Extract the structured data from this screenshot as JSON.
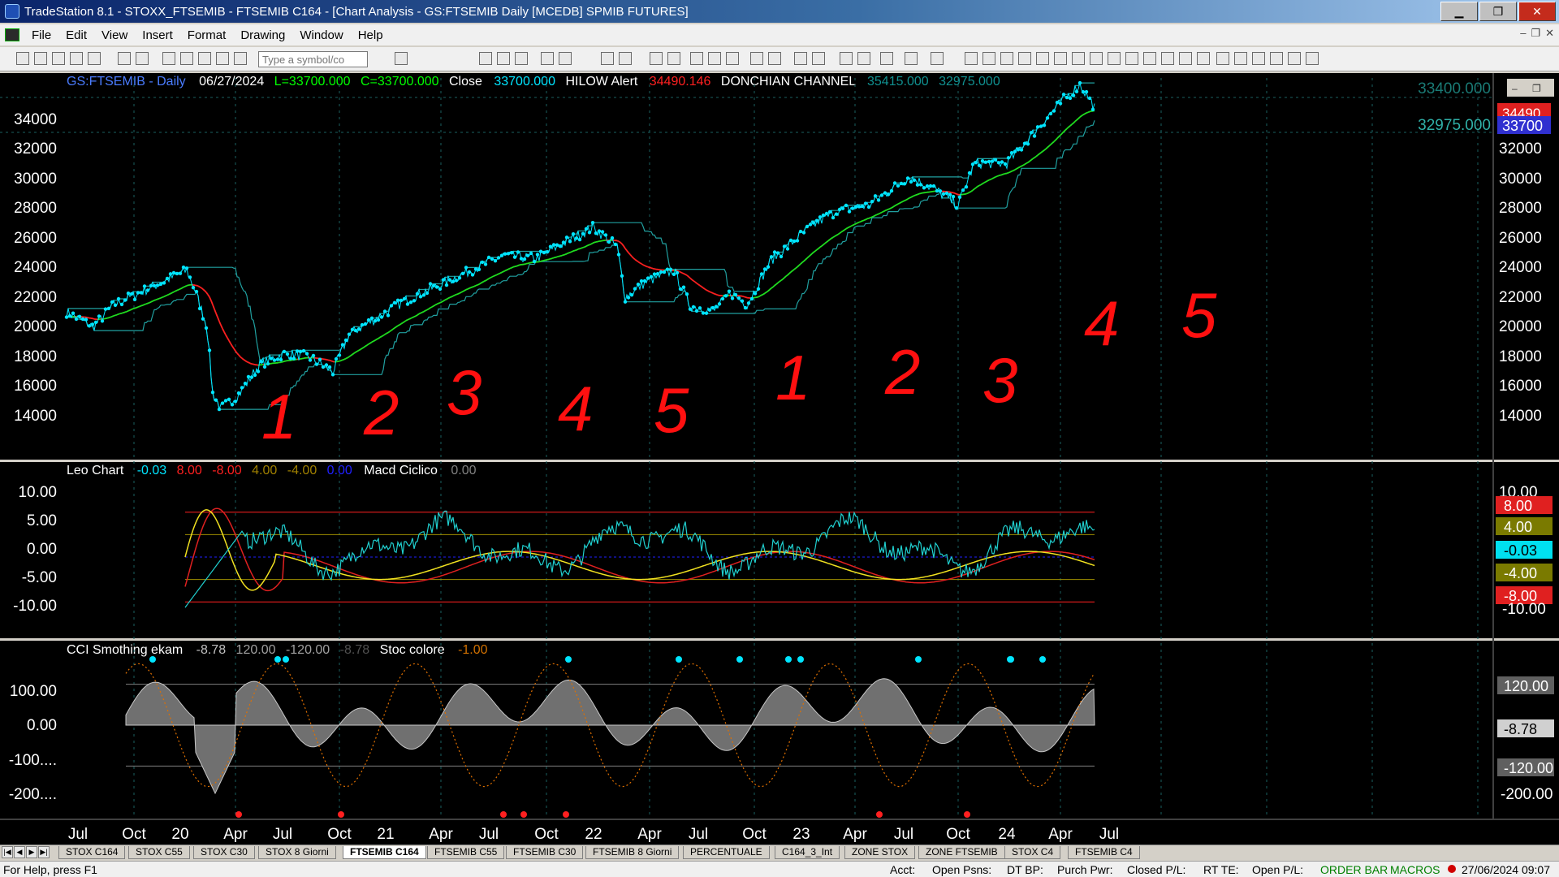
{
  "window": {
    "title": "TradeStation 8.1 - STOXX_FTSEMIB - FTSEMIB C164 - [Chart Analysis - GS:FTSEMIB  Daily  [MCEDB] SPMIB FUTURES]",
    "min": "▁",
    "max": "❐",
    "close": "✕"
  },
  "menu": [
    "File",
    "Edit",
    "View",
    "Insert",
    "Format",
    "Drawing",
    "Window",
    "Help"
  ],
  "mdi_controls": [
    "–",
    "❐",
    "✕"
  ],
  "toolbar": {
    "symbol_placeholder": "Type a symbol/co"
  },
  "price_header": {
    "symbol": "GS:FTSEMIB - Daily",
    "date": "06/27/2024",
    "low": "L=33700.000",
    "close": "C=33700.000",
    "close_label": "Close",
    "close_value": "33700.000",
    "hilow_label": "HILOW Alert",
    "hilow_value": "34490.146",
    "donchian_label": "DONCHIAN CHANNEL",
    "donchian_upper": "35415.000",
    "donchian_lower": "32975.000"
  },
  "price_axis": {
    "ticks": [
      "34000",
      "32000",
      "30000",
      "28000",
      "26000",
      "24000",
      "22000",
      "20000",
      "18000",
      "16000",
      "14000"
    ],
    "right_ticks": [
      "32000",
      "30000",
      "28000",
      "26000",
      "24000",
      "22000",
      "20000",
      "18000",
      "16000",
      "14000"
    ],
    "badge_red": "34490",
    "badge_blue": "33700",
    "level_label": "32975.000",
    "partial_top": "33400.000"
  },
  "wave_labels": [
    "1",
    "2",
    "3",
    "4",
    "5",
    "1",
    "2",
    "3",
    "4",
    "5"
  ],
  "leo_header": {
    "name": "Leo Chart",
    "v1": "-0.03",
    "v2": "8.00",
    "v3": "-8.00",
    "v4": "4.00",
    "v5": "-4.00",
    "v6": "0.00",
    "macd_label": "Macd Ciclico",
    "macd_value": "0.00"
  },
  "leo_axis": {
    "ticks": [
      "10.00",
      "5.00",
      "0.00",
      "-5.00",
      "-10.00"
    ],
    "badges": [
      "8.00",
      "4.00",
      "-0.03",
      "-4.00",
      "-8.00"
    ],
    "right_ticks": [
      "10.00",
      "-10.00"
    ]
  },
  "cci_header": {
    "name": "CCI Smothing ekam",
    "v1": "-8.78",
    "v2": "120.00",
    "v3": "-120.00",
    "v4": "-8.78",
    "stoc_label": "Stoc colore",
    "stoc_value": "-1.00"
  },
  "cci_axis": {
    "ticks": [
      "100.00",
      "0.00",
      "-100....",
      "-200...."
    ],
    "badges": [
      "120.00",
      "-8.78",
      "-120.00"
    ],
    "right_ticks": [
      "-200.00"
    ]
  },
  "time_axis": [
    "Jul",
    "Oct",
    "20",
    "Apr",
    "Jul",
    "Oct",
    "21",
    "Apr",
    "Jul",
    "Oct",
    "22",
    "Apr",
    "Jul",
    "Oct",
    "23",
    "Apr",
    "Jul",
    "Oct",
    "24",
    "Apr",
    "Jul"
  ],
  "tabs": [
    "STOX C164",
    "STOX C55",
    "STOX C30",
    "STOX 8 Giorni",
    "FTSEMIB C164",
    "FTSEMIB C55",
    "FTSEMIB C30",
    "FTSEMIB 8 Giorni",
    "PERCENTUALE",
    "C164_3_Int",
    "ZONE STOX",
    "ZONE FTSEMIB",
    "STOX C4",
    "FTSEMIB C4"
  ],
  "status": {
    "help": "For Help, press F1",
    "acct": "Acct:",
    "open_psns": "Open Psns:",
    "dt_bp": "DT BP:",
    "purch_pwr": "Purch Pwr:",
    "closed_pl": "Closed P/L:",
    "rt_te": "RT TE:",
    "open_pl": "Open P/L:",
    "order_bar": "ORDER BAR",
    "macros": "MACROS",
    "datetime": "27/06/2024 09:07"
  },
  "colors": {
    "price": "#00e5ff",
    "hilow_red": "#ff2020",
    "hilow_green": "#20e020",
    "donchian": "#20a0a0",
    "ink": "#ff0000",
    "grid": "#1a6060"
  }
}
